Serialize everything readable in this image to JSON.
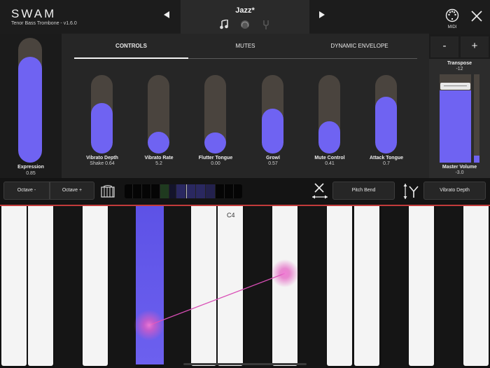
{
  "header": {
    "logo": "SWAM",
    "subtitle": "Tenor Bass Trombone - v1.6.0",
    "preset_name": "Jazz*",
    "prev_icon": "triangle-left-icon",
    "next_icon": "triangle-right-icon",
    "midi_label": "MIDI",
    "close_icon": "close-icon"
  },
  "expression": {
    "label": "Expression",
    "value": "0.85",
    "level": 0.85
  },
  "tabs": [
    {
      "label": "CONTROLS",
      "active": true
    },
    {
      "label": "MUTES",
      "active": false
    },
    {
      "label": "DYNAMIC ENVELOPE",
      "active": false
    }
  ],
  "controls": [
    {
      "label": "Vibrato Depth",
      "value": "Shake 0.64",
      "level": 0.64
    },
    {
      "label": "Vibrato Rate",
      "value": "5.2",
      "level": 0.28
    },
    {
      "label": "Flutter Tongue",
      "value": "0.00",
      "level": 0.27
    },
    {
      "label": "Growl",
      "value": "0.57",
      "level": 0.57
    },
    {
      "label": "Mute Control",
      "value": "0.41",
      "level": 0.41
    },
    {
      "label": "Attack Tongue",
      "value": "0.7",
      "level": 0.72
    }
  ],
  "transpose": {
    "minus": "-",
    "plus": "+",
    "label": "Transpose",
    "value": "-12"
  },
  "master_volume": {
    "label": "Master Volume",
    "value": "-3.0",
    "level": 0.82
  },
  "toolbar": {
    "octave_down": "Octave -",
    "octave_up": "Octave +",
    "pitch_bend": "Pitch Bend",
    "vibrato_depth": "Vibrato Depth",
    "keyboard_icon": "piano-keys-icon",
    "x_axis_icon": "x-axis-icon",
    "y_axis_icon": "y-axis-icon"
  },
  "keyboard": {
    "c4_label": "C4"
  },
  "colors": {
    "accent": "#6f63f2",
    "track": "#4a443e",
    "touch": "#e35bc0",
    "red_line": "#c23b3b"
  }
}
